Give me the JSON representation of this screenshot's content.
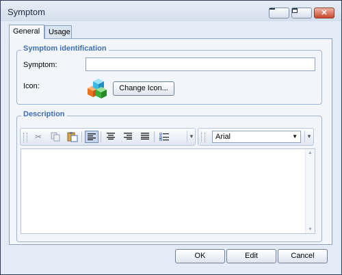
{
  "window": {
    "title": "Symptom"
  },
  "tabs": [
    {
      "label": "General"
    },
    {
      "label": "Usage"
    }
  ],
  "identification": {
    "legend": "Symptom identification",
    "symptom_label": "Symptom:",
    "symptom_value": "",
    "icon_label": "Icon:",
    "change_icon_label": "Change Icon..."
  },
  "description": {
    "legend": "Description",
    "font_value": "Arial",
    "text": ""
  },
  "toolbar_icons": [
    "scissors-icon",
    "copy-icon",
    "paste-icon",
    "align-left-icon",
    "align-center-icon",
    "align-right-icon",
    "justify-icon",
    "bullet-list-icon"
  ],
  "buttons": {
    "ok": "OK",
    "edit": "Edit",
    "cancel": "Cancel"
  },
  "colors": {
    "accent": "#3f6fb0",
    "close": "#c8462c"
  }
}
